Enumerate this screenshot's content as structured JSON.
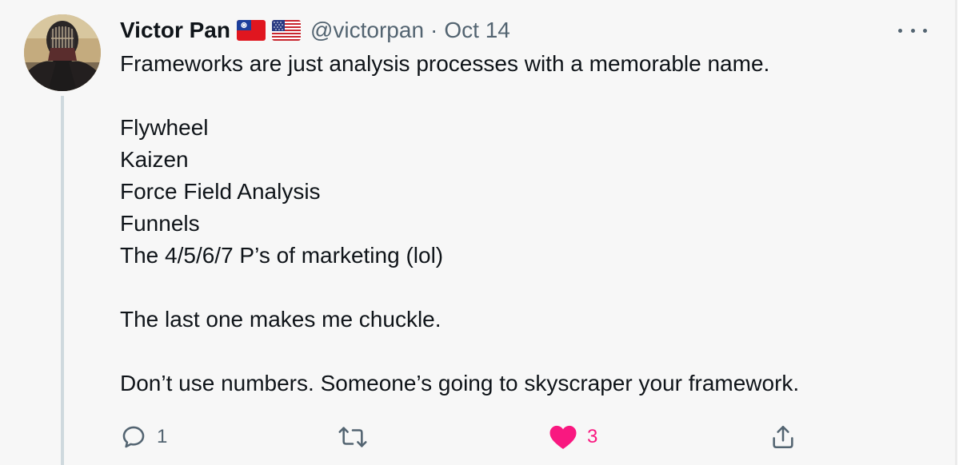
{
  "tweet": {
    "author_name": "Victor Pan",
    "flags": [
      "taiwan-flag",
      "us-flag"
    ],
    "handle": "@victorpan",
    "separator": "·",
    "date": "Oct 14",
    "lines": [
      "Frameworks are just analysis processes with a memorable name.",
      "",
      "Flywheel",
      "Kaizen",
      "Force Field Analysis",
      "Funnels",
      "The 4/5/6/7 P’s of marketing (lol)",
      "",
      "The last one makes me chuckle.",
      "",
      "Don’t use numbers. Someone’s going to skyscraper your framework."
    ],
    "actions": {
      "reply": {
        "icon": "reply-icon",
        "count": "1"
      },
      "retweet": {
        "icon": "retweet-icon",
        "count": ""
      },
      "like": {
        "icon": "heart-icon",
        "count": "3",
        "liked": true,
        "color": "#f91880"
      },
      "share": {
        "icon": "share-icon",
        "count": ""
      }
    },
    "more_icon": "more-icon",
    "colors": {
      "text": "#0f1419",
      "secondary": "#536471",
      "thread_line": "#cfd9de",
      "background": "#f7f7f7"
    }
  }
}
